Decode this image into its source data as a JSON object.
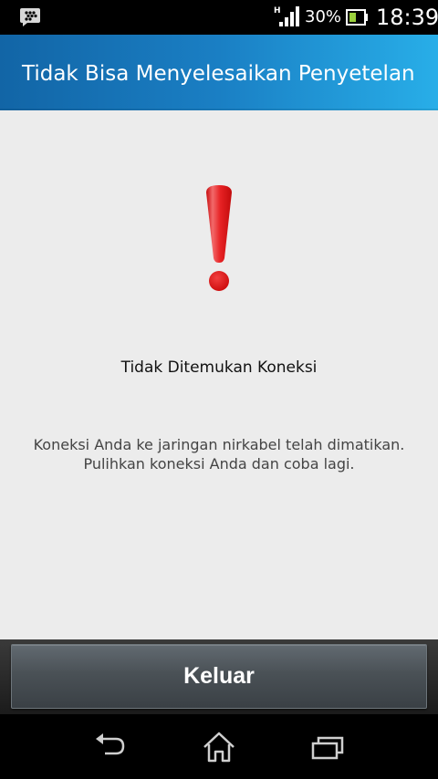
{
  "status_bar": {
    "network_type": "H",
    "battery_percent": "30%",
    "time": "18:39",
    "icons": [
      "bbm-icon",
      "signal-icon",
      "battery-icon"
    ]
  },
  "header": {
    "title": "Tidak Bisa Menyelesaikan Penyetelan"
  },
  "content": {
    "icon": "exclamation-icon",
    "title": "Tidak Ditemukan Koneksi",
    "message_line1": "Koneksi Anda ke jaringan nirkabel telah dimatikan.",
    "message_line2": "Pulihkan koneksi Anda dan coba lagi."
  },
  "actions": {
    "exit_label": "Keluar"
  },
  "nav_bar": {
    "icons": [
      "back-icon",
      "home-icon",
      "recent-apps-icon"
    ]
  },
  "colors": {
    "header_start": "#1265a6",
    "header_end": "#28aee8",
    "content_bg": "#ececec",
    "alert_red": "#d80f10"
  }
}
